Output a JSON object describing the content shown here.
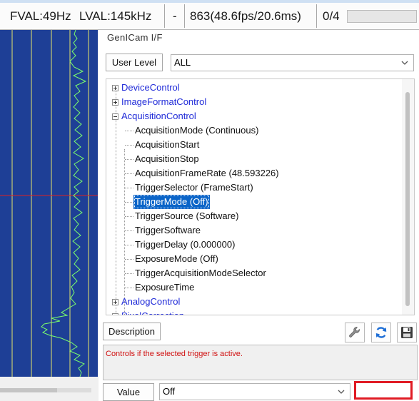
{
  "status_bar": {
    "fval": "FVAL:49Hz",
    "lval": "LVAL:145kHz",
    "dash": "-",
    "frames": "863(48.6fps/20.6ms)",
    "count": "0/4"
  },
  "panel": {
    "title": "GenICam I/F",
    "user_level_label": "User Level",
    "user_level_value": "ALL"
  },
  "tree": {
    "categories": {
      "device_control": "DeviceControl",
      "image_format_control": "ImageFormatControl",
      "acquisition_control": "AcquisitionControl",
      "analog_control": "AnalogControl",
      "pixel_correction": "PixelCorrection"
    },
    "acquisition_items": [
      "AcquisitionMode (Continuous)",
      "AcquisitionStart",
      "AcquisitionStop",
      "AcquisitionFrameRate (48.593226)",
      "TriggerSelector (FrameStart)",
      "TriggerMode (Off)",
      "TriggerSource (Software)",
      "TriggerSoftware",
      "TriggerDelay (0.000000)",
      "ExposureMode (Off)",
      "TriggerAcquisitionModeSelector",
      "ExposureTime"
    ],
    "selected_item": "TriggerMode (Off)"
  },
  "description": {
    "button_label": "Description",
    "text": "Controls if the selected trigger is active."
  },
  "value": {
    "button_label": "Value",
    "current": "Off"
  },
  "icons": {
    "settings": "wrench-icon",
    "refresh": "refresh-icon",
    "save": "save-icon"
  },
  "colors": {
    "scope_background": "#1e3f96",
    "waveform": "#7cff6b",
    "grid_lines": "#e6e66a",
    "cursor_line": "#e02020",
    "selection": "#0a64c8",
    "category_text": "#1f2ad8",
    "description_text": "#d01010",
    "highlight_box": "#e01b24"
  }
}
